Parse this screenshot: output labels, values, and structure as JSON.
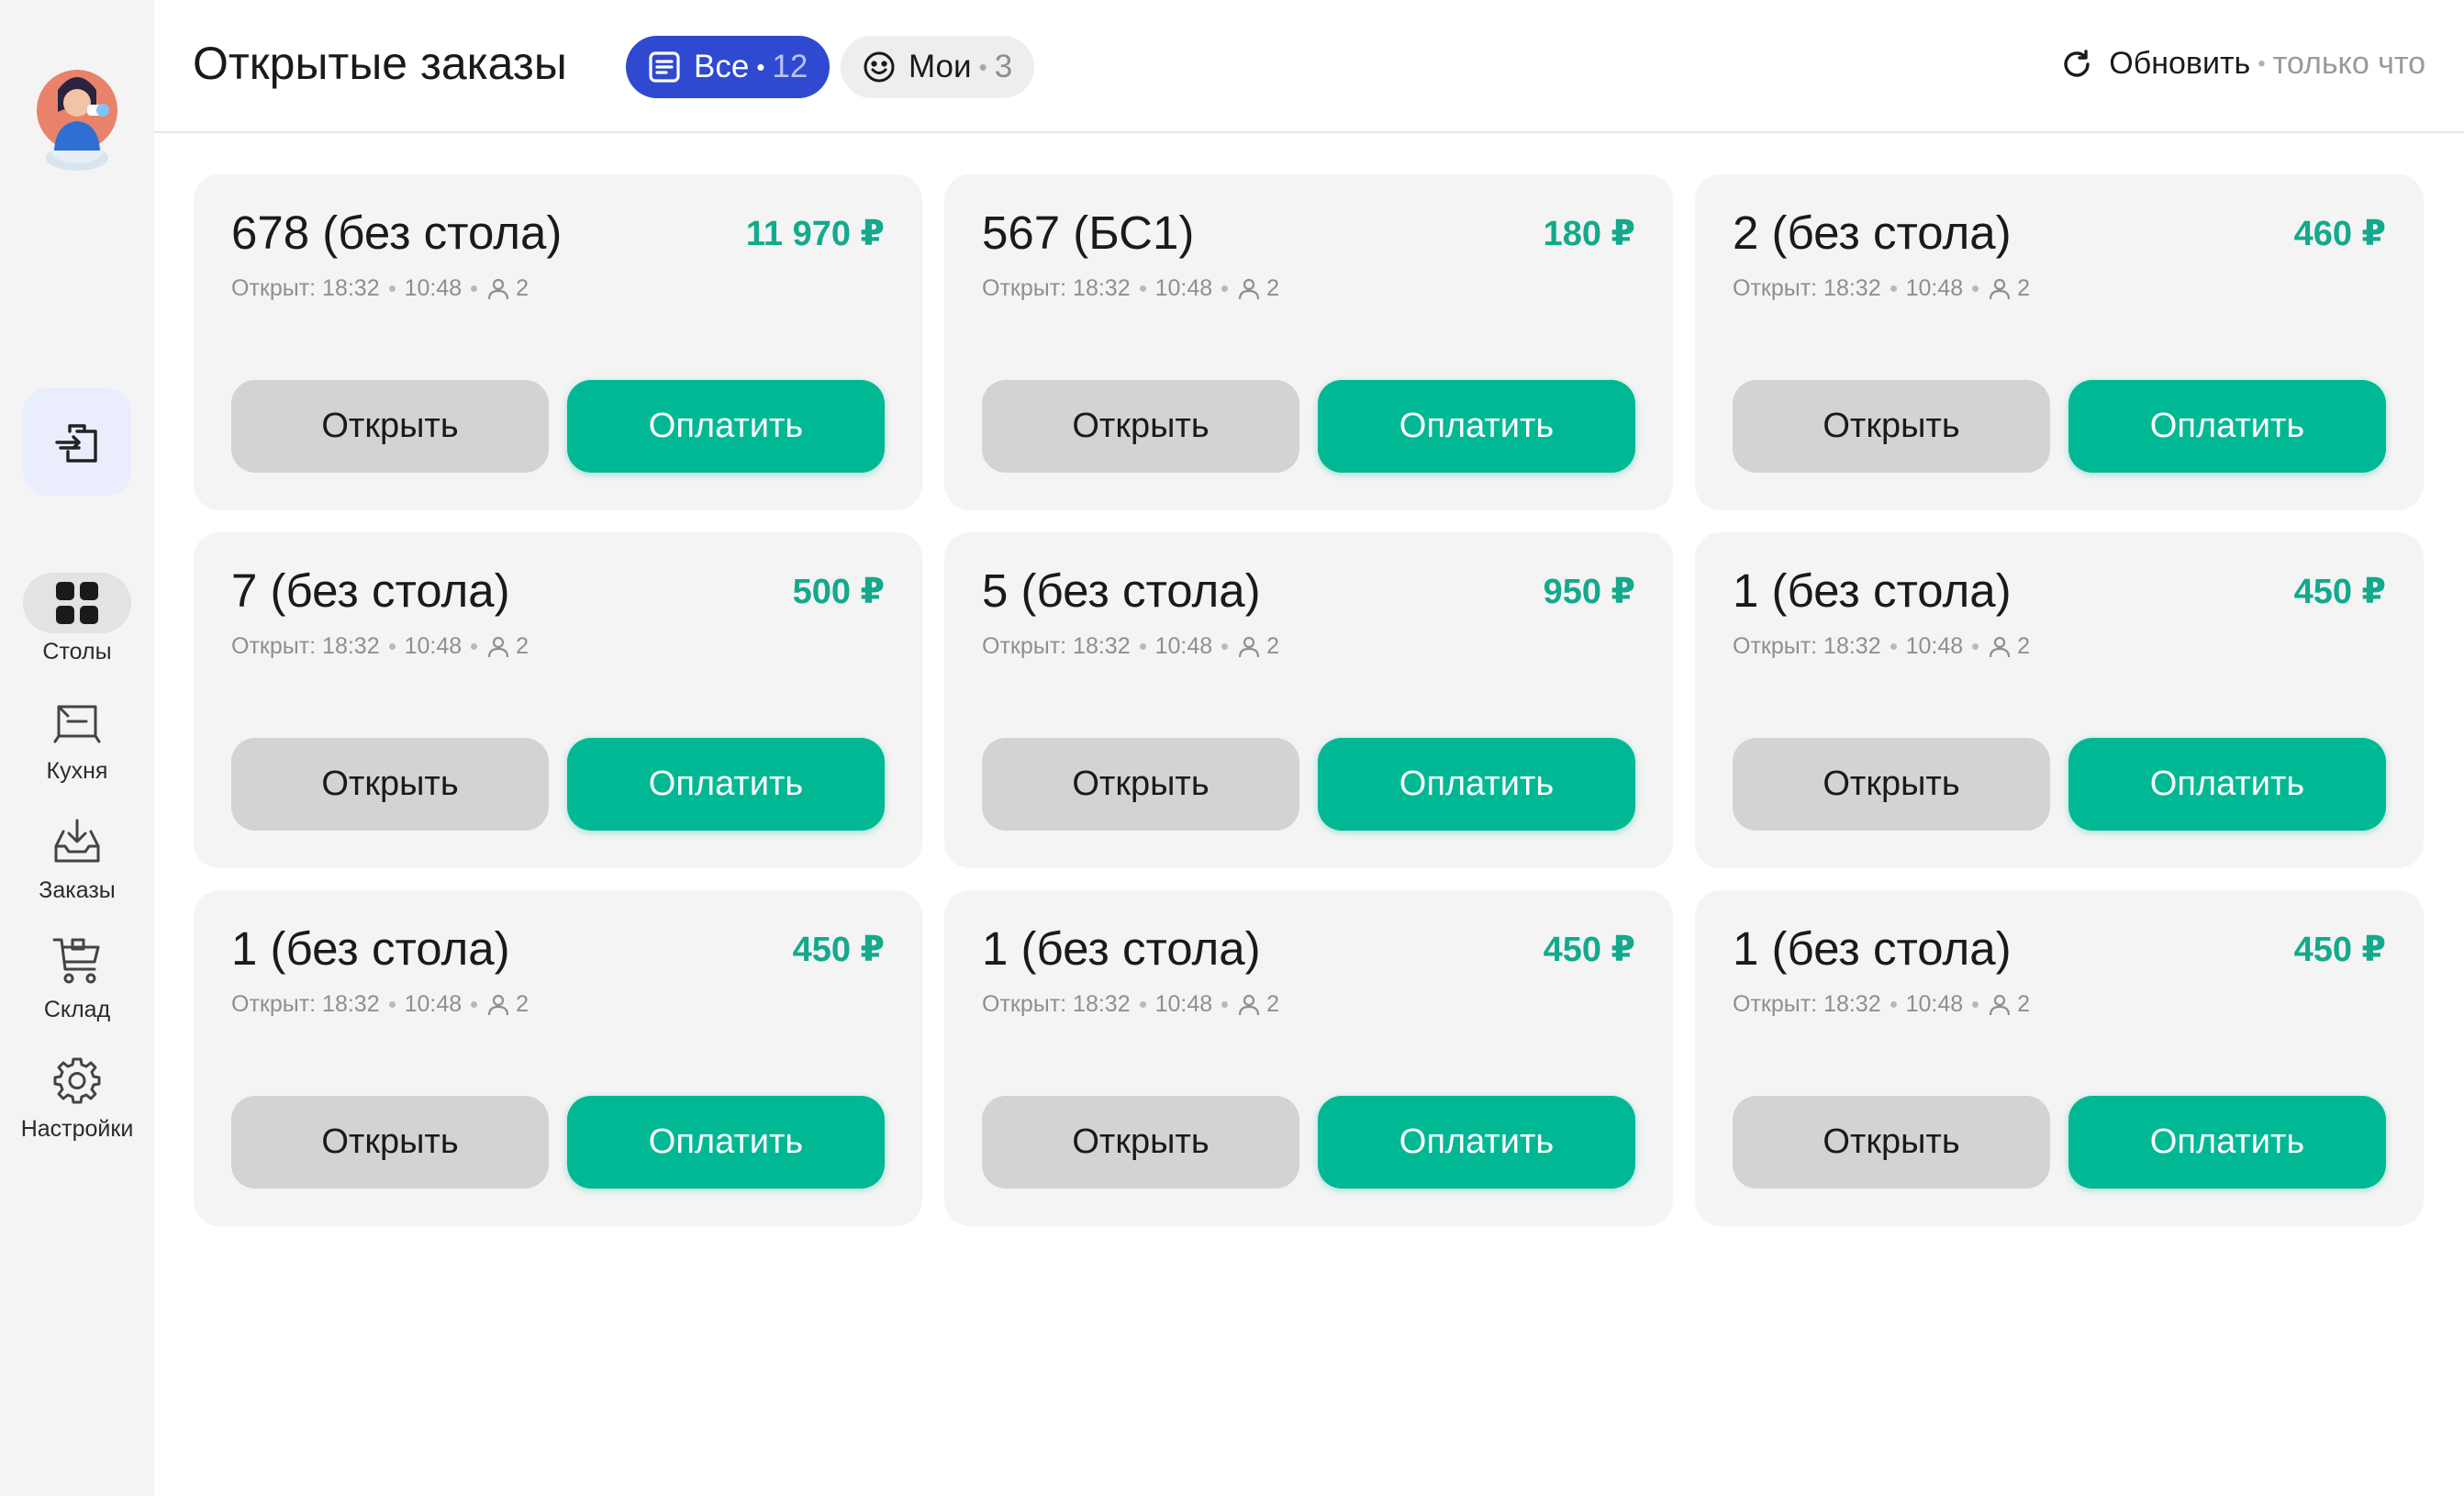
{
  "header": {
    "title": "Открытые заказы",
    "filters": {
      "all_label": "Все",
      "all_count": "12",
      "mine_label": "Мои",
      "mine_count": "3"
    },
    "refresh_label": "Обновить",
    "refresh_time": "только что"
  },
  "sidebar": {
    "nav": [
      {
        "label": "Столы",
        "icon": "grid-icon",
        "active": true
      },
      {
        "label": "Кухня",
        "icon": "kitchen-icon"
      },
      {
        "label": "Заказы",
        "icon": "inbox-download-icon"
      },
      {
        "label": "Склад",
        "icon": "cart-icon"
      },
      {
        "label": "Настройки",
        "icon": "gear-icon"
      }
    ]
  },
  "orders": [
    {
      "title": "678 (без стола)",
      "amount": "11 970 ₽",
      "opened_label": "Открыт: 18:32",
      "time": "10:48",
      "guests": "2",
      "open_label": "Открыть",
      "pay_label": "Оплатить"
    },
    {
      "title": "567 (БС1)",
      "amount": "180 ₽",
      "opened_label": "Открыт: 18:32",
      "time": "10:48",
      "guests": "2",
      "open_label": "Открыть",
      "pay_label": "Оплатить"
    },
    {
      "title": "2 (без стола)",
      "amount": "460 ₽",
      "opened_label": "Открыт: 18:32",
      "time": "10:48",
      "guests": "2",
      "open_label": "Открыть",
      "pay_label": "Оплатить"
    },
    {
      "title": "7 (без стола)",
      "amount": "500 ₽",
      "opened_label": "Открыт: 18:32",
      "time": "10:48",
      "guests": "2",
      "open_label": "Открыть",
      "pay_label": "Оплатить"
    },
    {
      "title": "5 (без стола)",
      "amount": "950 ₽",
      "opened_label": "Открыт: 18:32",
      "time": "10:48",
      "guests": "2",
      "open_label": "Открыть",
      "pay_label": "Оплатить"
    },
    {
      "title": "1 (без стола)",
      "amount": "450 ₽",
      "opened_label": "Открыт: 18:32",
      "time": "10:48",
      "guests": "2",
      "open_label": "Открыть",
      "pay_label": "Оплатить"
    },
    {
      "title": "1 (без стола)",
      "amount": "450 ₽",
      "opened_label": "Открыт: 18:32",
      "time": "10:48",
      "guests": "2",
      "open_label": "Открыть",
      "pay_label": "Оплатить"
    },
    {
      "title": "1 (без стола)",
      "amount": "450 ₽",
      "opened_label": "Открыт: 18:32",
      "time": "10:48",
      "guests": "2",
      "open_label": "Открыть",
      "pay_label": "Оплатить"
    },
    {
      "title": "1 (без стола)",
      "amount": "450 ₽",
      "opened_label": "Открыт: 18:32",
      "time": "10:48",
      "guests": "2",
      "open_label": "Открыть",
      "pay_label": "Оплатить"
    }
  ],
  "colors": {
    "accent": "#2f49d1",
    "pay": "#00b894",
    "amount": "#13a98c",
    "open_button": "#d3d3d3",
    "card": "#f4f4f4",
    "sidebar": "#f4f4f4"
  }
}
